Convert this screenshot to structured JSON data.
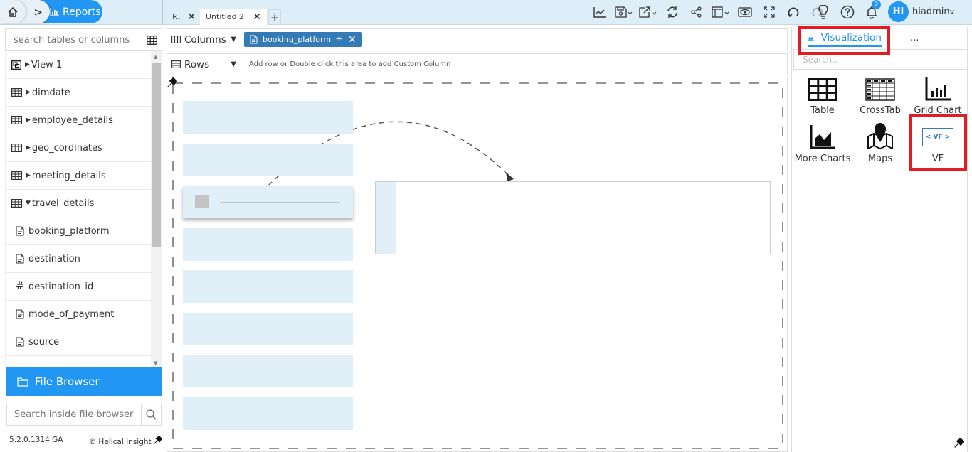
{
  "breadcrumb": {
    "home_icon": "home-icon",
    "separator": ">",
    "current": "Reports",
    "current_icon": "bar-chart-icon"
  },
  "tabs": [
    {
      "label": "R..",
      "close": "✕",
      "active": false
    },
    {
      "label": "Untitled 2",
      "close": "✕",
      "active": true
    }
  ],
  "tab_add": "+",
  "toolbar": {
    "icons": [
      "line-chart-icon",
      "save-icon",
      "export-icon",
      "refresh-icon",
      "share-icon",
      "layout-icon",
      "preview-icon",
      "fullscreen-icon",
      "undo-icon",
      "redo-icon"
    ],
    "dropdown_caret": "v"
  },
  "header_right": {
    "tips_icon": "lightbulb-icon",
    "help_icon": "help-icon",
    "notifications_icon": "bell-icon",
    "notifications_count": "2",
    "avatar_initials": "HI",
    "username": "hiadmin",
    "user_caret": "v"
  },
  "left_panel": {
    "search_placeholder": "search tables or columns",
    "tree": [
      {
        "label": "View 1",
        "type": "view",
        "expanded": false,
        "level": 0
      },
      {
        "label": "dimdate",
        "type": "table",
        "expanded": false,
        "level": 0
      },
      {
        "label": "employee_details",
        "type": "table",
        "expanded": false,
        "level": 0
      },
      {
        "label": "geo_cordinates",
        "type": "table",
        "expanded": false,
        "level": 0
      },
      {
        "label": "meeting_details",
        "type": "table",
        "expanded": false,
        "level": 0
      },
      {
        "label": "travel_details",
        "type": "table",
        "expanded": true,
        "level": 0
      },
      {
        "label": "booking_platform",
        "type": "text",
        "level": 1
      },
      {
        "label": "destination",
        "type": "text",
        "level": 1
      },
      {
        "label": "destination_id",
        "type": "number",
        "level": 1
      },
      {
        "label": "mode_of_payment",
        "type": "text",
        "level": 1
      },
      {
        "label": "source",
        "type": "text",
        "level": 1
      }
    ],
    "file_browser_label": "File Browser",
    "file_search_placeholder": "Search inside file browser",
    "version": "5.2.0.1314 GA",
    "brand": "Helical Insight",
    "copyright": "©"
  },
  "shelves": {
    "columns_label": "Columns",
    "rows_label": "Rows",
    "columns_pills": [
      {
        "label": "booking_platform",
        "divider": "÷",
        "remove": "✕"
      }
    ],
    "rows_hint": "Add row or Double click this area to add Custom Column"
  },
  "right_panel": {
    "tab_label": "Visualization",
    "more_label": "...",
    "search_placeholder": "Search..",
    "visualizations": [
      {
        "label": "Table",
        "icon": "table-icon"
      },
      {
        "label": "CrossTab",
        "icon": "crosstab-icon"
      },
      {
        "label": "Grid Chart",
        "icon": "grid-chart-icon"
      },
      {
        "label": "More Charts",
        "icon": "area-chart-icon"
      },
      {
        "label": "Maps",
        "icon": "map-pin-icon"
      },
      {
        "label": "VF",
        "icon": "vf-icon",
        "icon_text": "< VF >"
      }
    ],
    "highlight_color": "#e51b23"
  },
  "colors": {
    "accent": "#2196f3",
    "pill": "#337ab7",
    "topbar": "#deeef9",
    "placeholder_block": "#e1f0f8"
  }
}
